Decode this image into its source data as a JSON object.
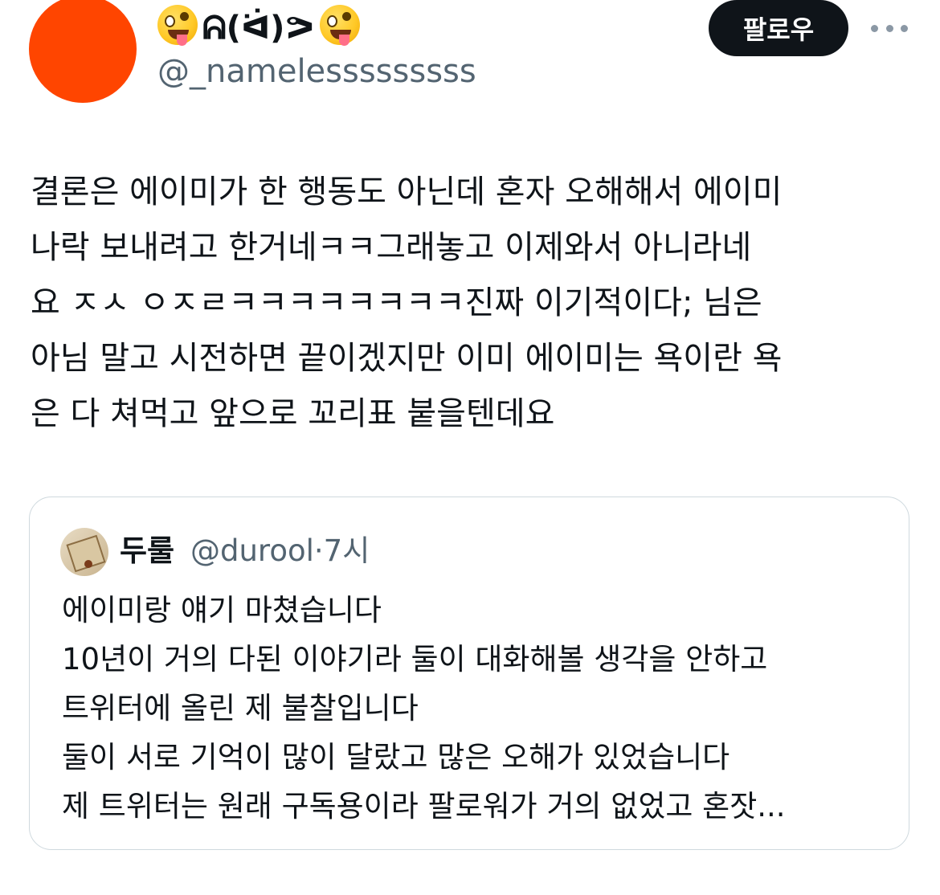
{
  "author": {
    "display_name": "ᕱ(ᐛ)ᕗ",
    "emoji_left": "zany-face-emoji",
    "emoji_right": "zany-face-emoji",
    "handle": "@_namelesssssssss",
    "avatar_color": "#ff4500"
  },
  "follow_label": "팔로우",
  "more_icon": "more-horizontal-icon",
  "tweet": {
    "lines": [
      "결론은 에이미가 한 행동도 아닌데 혼자 오해해서 에이미",
      "나락 보내려고 한거네ㅋㅋ그래놓고 이제와서 아니라네",
      "요 ㅈㅅ ㅇㅈㄹㅋㅋㅋㅋㅋㅋㅋㅋ진짜 이기적이다; 님은",
      "아님 말고 시전하면 끝이겠지만 이미 에이미는 욕이란 욕",
      "은 다 쳐먹고 앞으로 꼬리표 붙을텐데요"
    ]
  },
  "quote": {
    "author_name": "두룰",
    "handle": "@durool",
    "separator": "·",
    "time": "7시",
    "lines": [
      "에이미랑 얘기 마쳤습니다",
      "10년이 거의 다된 이야기라 둘이 대화해볼 생각을 안하고",
      "트위터에 올린 제 불찰입니다",
      "둘이 서로 기억이 많이 달랐고 많은 오해가 있었습니다",
      "제 트위터는 원래 구독용이라 팔로워가 거의 없었고 혼잣..."
    ]
  }
}
